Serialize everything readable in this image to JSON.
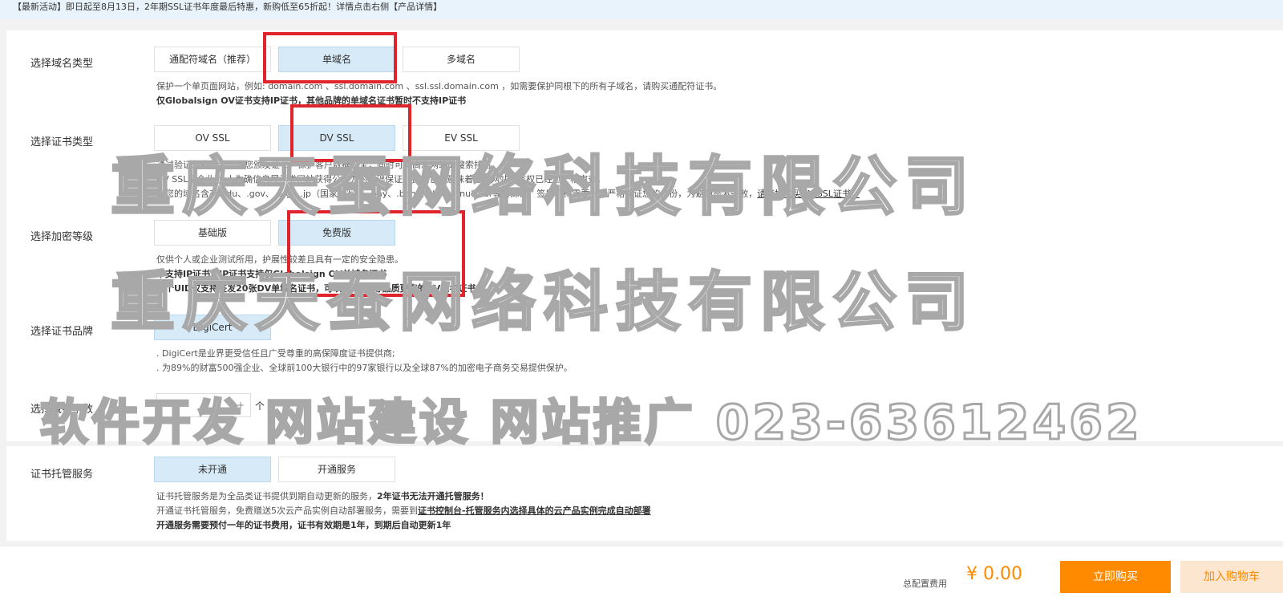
{
  "notice": "【最新活动】即日起至8月13日，2年期SSL证书年度最后特惠，新购低至65折起！详情点击右侧【产品详情】",
  "domain_type": {
    "label": "选择域名类型",
    "options": [
      "通配符域名（推荐）",
      "单域名",
      "多域名"
    ],
    "selected": "单域名",
    "desc_line1": "保护一个单页面网站，例如: domain.com 、ssl.domain.com 、ssl.ssl.domain.com ，如需要保护同根下的所有子域名，请购买通配符证书。",
    "desc_line2": "仅Globalsign OV证书支持IP证书，其他品牌的单域名证书暂时不支持IP证书"
  },
  "cert_type": {
    "label": "选择证书类型",
    "options": [
      "OV SSL",
      "DV SSL",
      "EV SSL"
    ],
    "selected": "DV SSL",
    "desc_line1": "通过验证您的域名，为您颁发证书，保护客户数据安全，同时可提高您网站的搜索排名。",
    "desc_line2": "DV SSL是企业/个人为确信息展示类网站获得公信力的基础保证，拥有它才意味着您的网站所有权已经过严格审查。",
    "desc_line3": "如您的域名含有.edu、.gov、.org、.jp（国家缩写）、.pay、.bank、.live、.nuclear等特殊词，签发机构需要人工严格验证您的身份，为避免签发失败，",
    "desc_line3_link": "请直接购买OV SSL证书。"
  },
  "encryption": {
    "label": "选择加密等级",
    "options": [
      "基础版",
      "免费版"
    ],
    "selected": "免费版",
    "desc_line1": "仅供个人或企业测试所用，护展性较差且具有一定的安全隐患。",
    "desc_line2": "不支持IP证书，IP证书支持仅Globalsign OV单域名证书",
    "desc_line3": "每个UID仅支持签发20张DV单域名证书，可以购买OV等品质更高的DV域名证书"
  },
  "brand": {
    "label": "选择证书品牌",
    "options": [
      "DigiCert"
    ],
    "selected": "DigiCert",
    "desc_line1": ". DigiCert是业界更受信任且广受尊重的高保障度证书提供商;",
    "desc_line2": ". 为89%的财富500强企业、全球前100大银行中的97家银行以及全球87%的加密电子商务交易提供保护。"
  },
  "domain_count": {
    "label": "选择域名个数",
    "minus": "-",
    "value": "1",
    "plus": "+",
    "unit": "个"
  },
  "hosting": {
    "label": "证书托管服务",
    "options": [
      "未开通",
      "开通服务"
    ],
    "selected": "未开通",
    "desc_line1": "证书托管服务是为全品类证书提供到期自动更新的服务，",
    "desc_line1_bold": "2年证书无法开通托管服务！",
    "desc_line2": "开通证书托管服务，免费赠送5次云产品实例自动部署服务，需要到",
    "desc_line2_link": "证书控制台-托管服务内选择具体的云产品实例完成自动部署",
    "desc_line3": "开通服务需要预付一年的证书费用，证书有效期是1年，到期后自动更新1年"
  },
  "footer": {
    "total_label": "总配置费用",
    "total_price": "¥ 0.00",
    "buy_label": "立即购买",
    "cart_label": "加入购物车"
  },
  "watermark": {
    "line1": "重庆天蚕网络科技有限公司",
    "line2": "重庆天蚕网络科技有限公司",
    "line3": "软件开发 网站建设 网站推广 023-63612462"
  },
  "colors": {
    "accent": "#ff8a00",
    "selected_bg": "#d7eaf8",
    "highlight_box": "#e0242b",
    "notice_bg": "#e9f3fb"
  }
}
